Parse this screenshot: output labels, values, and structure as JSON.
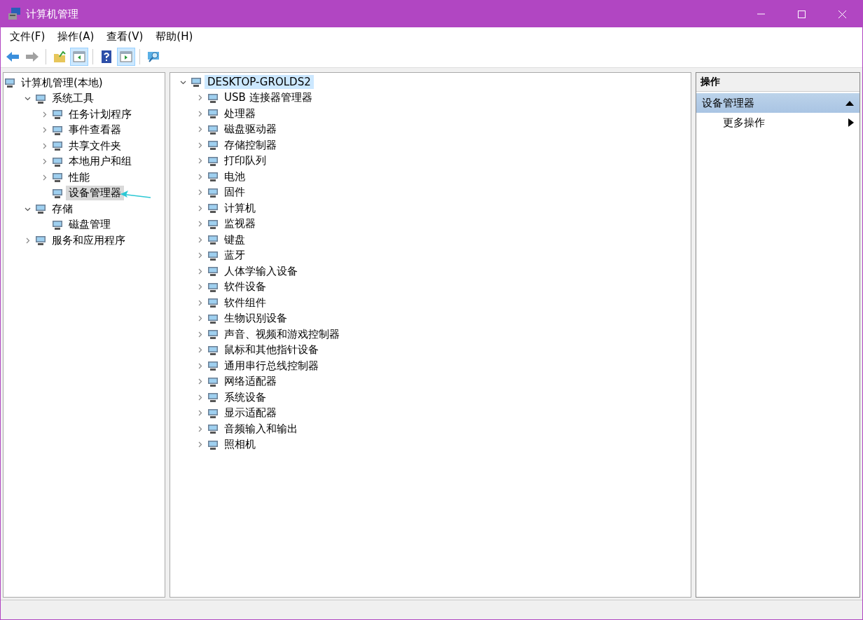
{
  "window": {
    "title": "计算机管理"
  },
  "menu": [
    "文件(F)",
    "操作(A)",
    "查看(V)",
    "帮助(H)"
  ],
  "toolbar": [
    {
      "kind": "back",
      "pressed": false,
      "disabled": false
    },
    {
      "kind": "forward",
      "pressed": false,
      "disabled": true
    },
    {
      "kind": "sep"
    },
    {
      "kind": "up",
      "pressed": false,
      "disabled": false
    },
    {
      "kind": "panel-left",
      "pressed": true,
      "disabled": false
    },
    {
      "kind": "sep"
    },
    {
      "kind": "help",
      "pressed": false,
      "disabled": false
    },
    {
      "kind": "panel-right",
      "pressed": true,
      "disabled": false
    },
    {
      "kind": "sep"
    },
    {
      "kind": "monitor",
      "pressed": false,
      "disabled": false
    }
  ],
  "nav_tree": [
    {
      "label": "计算机管理(本地)",
      "selected": false,
      "children": [
        {
          "label": "系统工具",
          "expanded": true,
          "selected": false,
          "children": [
            {
              "label": "任务计划程序",
              "expanded": false,
              "selected": false
            },
            {
              "label": "事件查看器",
              "expanded": false,
              "selected": false
            },
            {
              "label": "共享文件夹",
              "expanded": false,
              "selected": false
            },
            {
              "label": "本地用户和组",
              "expanded": false,
              "selected": false
            },
            {
              "label": "性能",
              "expanded": false,
              "selected": false
            },
            {
              "label": "设备管理器",
              "selected": true
            }
          ]
        },
        {
          "label": "存储",
          "expanded": true,
          "selected": false,
          "children": [
            {
              "label": "磁盘管理",
              "selected": false
            }
          ]
        },
        {
          "label": "服务和应用程序",
          "expanded": false,
          "selected": false
        }
      ]
    }
  ],
  "device_tree": [
    {
      "label": "DESKTOP-GROLDS2",
      "expanded": true,
      "selected": true,
      "children": [
        {
          "label": "USB 连接器管理器",
          "expanded": false,
          "selected": false
        },
        {
          "label": "处理器",
          "expanded": false,
          "selected": false
        },
        {
          "label": "磁盘驱动器",
          "expanded": false,
          "selected": false
        },
        {
          "label": "存储控制器",
          "expanded": false,
          "selected": false
        },
        {
          "label": "打印队列",
          "expanded": false,
          "selected": false
        },
        {
          "label": "电池",
          "expanded": false,
          "selected": false
        },
        {
          "label": "固件",
          "expanded": false,
          "selected": false
        },
        {
          "label": "计算机",
          "expanded": false,
          "selected": false
        },
        {
          "label": "监视器",
          "expanded": false,
          "selected": false
        },
        {
          "label": "键盘",
          "expanded": false,
          "selected": false
        },
        {
          "label": "蓝牙",
          "expanded": false,
          "selected": false
        },
        {
          "label": "人体学输入设备",
          "expanded": false,
          "selected": false
        },
        {
          "label": "软件设备",
          "expanded": false,
          "selected": false
        },
        {
          "label": "软件组件",
          "expanded": false,
          "selected": false
        },
        {
          "label": "生物识别设备",
          "expanded": false,
          "selected": false
        },
        {
          "label": "声音、视频和游戏控制器",
          "expanded": false,
          "selected": false
        },
        {
          "label": "鼠标和其他指针设备",
          "expanded": false,
          "selected": false
        },
        {
          "label": "通用串行总线控制器",
          "expanded": false,
          "selected": false
        },
        {
          "label": "网络适配器",
          "expanded": false,
          "selected": false
        },
        {
          "label": "系统设备",
          "expanded": false,
          "selected": false
        },
        {
          "label": "显示适配器",
          "expanded": false,
          "selected": false
        },
        {
          "label": "音频输入和输出",
          "expanded": false,
          "selected": false
        },
        {
          "label": "照相机",
          "expanded": false,
          "selected": false
        }
      ]
    }
  ],
  "actions": {
    "header": "操作",
    "sections": [
      {
        "title": "设备管理器",
        "expanded": true,
        "items": [
          {
            "label": "更多操作"
          }
        ]
      }
    ]
  }
}
